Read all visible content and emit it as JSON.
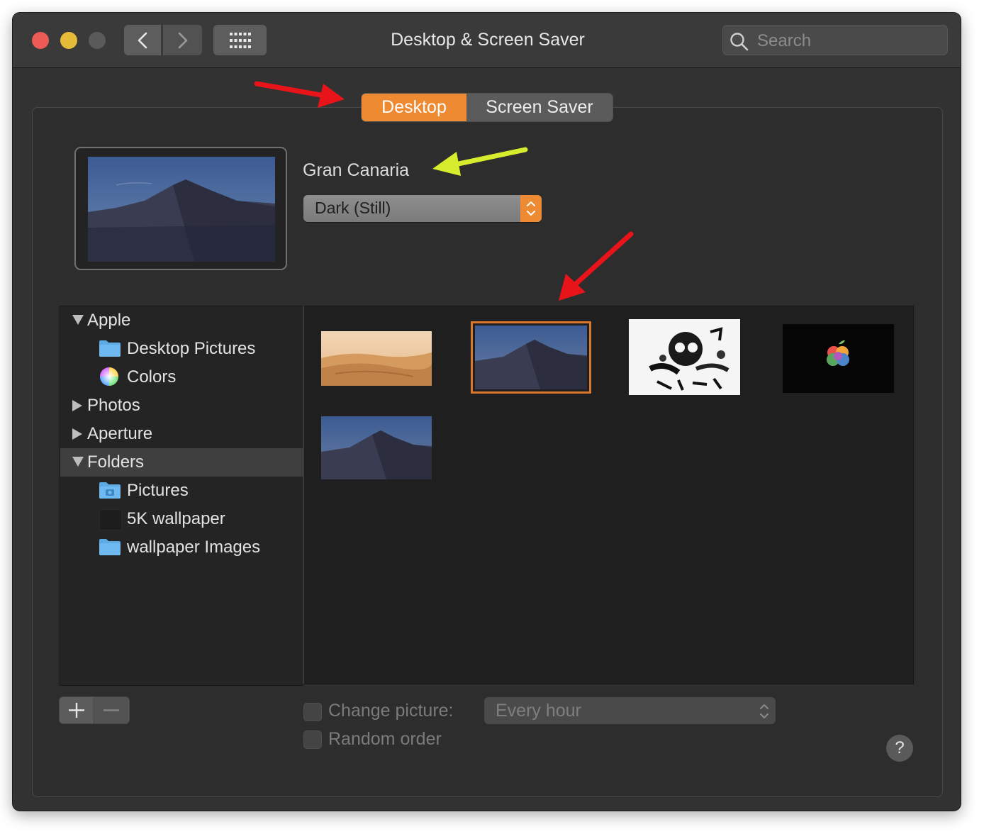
{
  "window": {
    "title": "Desktop & Screen Saver",
    "search_placeholder": "Search"
  },
  "tabs": [
    {
      "label": "Desktop",
      "active": true
    },
    {
      "label": "Screen Saver",
      "active": false
    }
  ],
  "wallpaper": {
    "name": "Gran Canaria",
    "mode_value": "Dark (Still)"
  },
  "sidebar": {
    "items": [
      {
        "label": "Apple",
        "type": "group",
        "expanded": true
      },
      {
        "label": "Desktop Pictures",
        "type": "folder-icon"
      },
      {
        "label": "Colors",
        "type": "color-wheel-icon"
      },
      {
        "label": "Photos",
        "type": "group",
        "expanded": false
      },
      {
        "label": "Aperture",
        "type": "group",
        "expanded": false
      },
      {
        "label": "Folders",
        "type": "group",
        "expanded": true,
        "selected": true
      },
      {
        "label": "Pictures",
        "type": "pictures-folder-icon"
      },
      {
        "label": "5K wallpaper",
        "type": "dark-thumbnail-icon"
      },
      {
        "label": "wallpaper Images",
        "type": "folder-icon"
      }
    ]
  },
  "thumbnails": [
    {
      "name": "desert-dunes-day",
      "selected": false
    },
    {
      "name": "mojave-dunes-night",
      "selected": true
    },
    {
      "name": "sketch-art-black-white",
      "selected": false
    },
    {
      "name": "apple-logo-dark",
      "selected": false
    },
    {
      "name": "mojave-dunes-night-2",
      "selected": false
    }
  ],
  "footer": {
    "add_icon": "plus-icon",
    "remove_icon": "minus-icon",
    "change_picture_label": "Change picture:",
    "change_picture_checked": false,
    "interval_value": "Every hour",
    "random_order_label": "Random order",
    "random_order_checked": false,
    "help_label": "?"
  },
  "colors": {
    "accent": "#ee8a32",
    "annotation_red": "#e8141a",
    "annotation_yellow": "#d8ec2e"
  }
}
